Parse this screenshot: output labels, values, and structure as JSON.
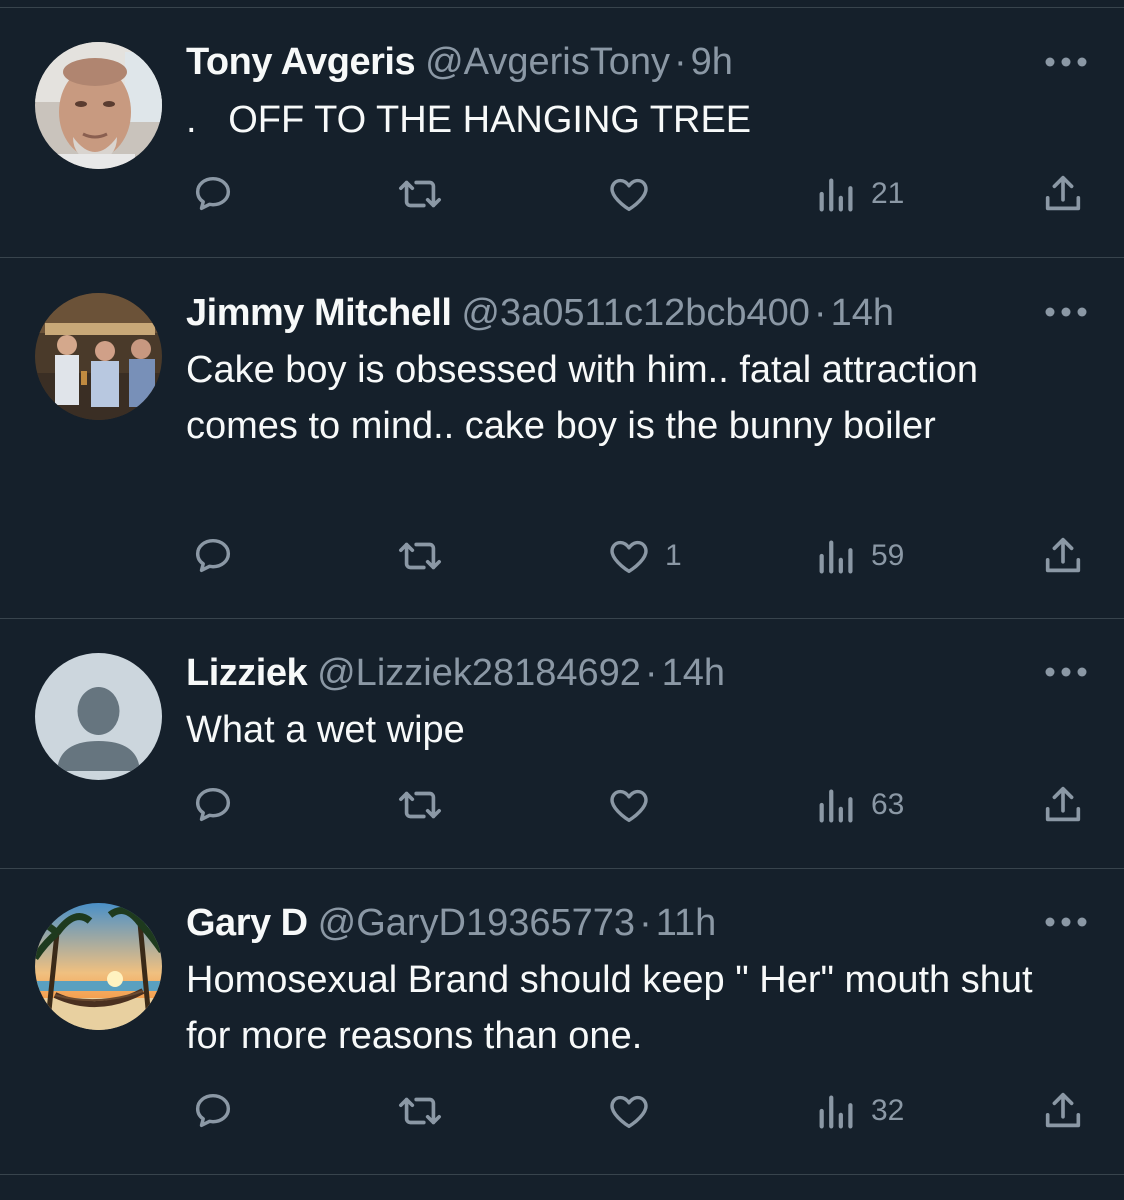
{
  "tweets": [
    {
      "name": "Tony Avgeris",
      "handle": "@AvgerisTony",
      "separator": "·",
      "time": "9h",
      "text": ".   OFF TO THE HANGING TREE",
      "likes": "",
      "views": "21",
      "avatar": "photo-man-face"
    },
    {
      "name": "Jimmy Mitchell",
      "handle": "@3a0511c12bcb400",
      "separator": "·",
      "time": "14h",
      "text": "Cake boy is obsessed with him.. fatal attraction comes to mind.. cake boy is the bunny boiler",
      "likes": "1",
      "views": "59",
      "avatar": "photo-group-pub"
    },
    {
      "name": "Lizziek",
      "handle": "@Lizziek28184692",
      "separator": "·",
      "time": "14h",
      "text": "What a wet wipe",
      "likes": "",
      "views": "63",
      "avatar": "default-profile"
    },
    {
      "name": "Gary D",
      "handle": "@GaryD19365773",
      "separator": "·",
      "time": "11h",
      "text": "Homosexual Brand should keep \" Her\" mouth shut for more reasons than one.",
      "likes": "",
      "views": "32",
      "avatar": "photo-beach-hammock"
    }
  ],
  "icons": {
    "reply": "reply-icon",
    "retweet": "retweet-icon",
    "like": "heart-icon",
    "views": "views-icon",
    "share": "share-icon",
    "more": "more-icon"
  },
  "colors": {
    "background": "#15202b",
    "text": "#f7f9f9",
    "secondary": "#8b98a5",
    "divider": "#38444d"
  }
}
